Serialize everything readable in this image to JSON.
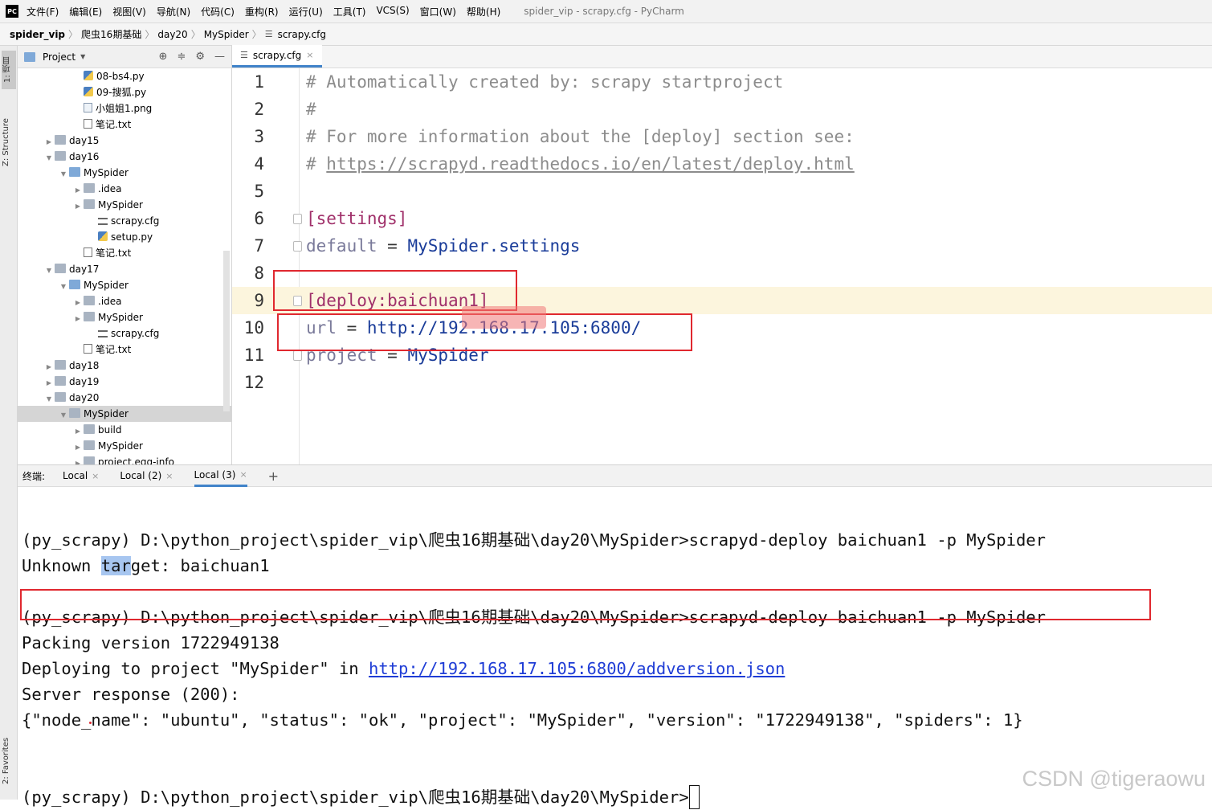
{
  "menubar": {
    "logo": "PC",
    "items": [
      "文件(F)",
      "编辑(E)",
      "视图(V)",
      "导航(N)",
      "代码(C)",
      "重构(R)",
      "运行(U)",
      "工具(T)",
      "VCS(S)",
      "窗口(W)",
      "帮助(H)"
    ],
    "window_title": "spider_vip - scrapy.cfg - PyCharm"
  },
  "breadcrumb": [
    "spider_vip",
    "爬虫16期基础",
    "day20",
    "MySpider",
    "scrapy.cfg"
  ],
  "left_strip": {
    "project": "1: 项目",
    "structure": "Z: Structure",
    "favorites": "2: Favorites"
  },
  "project_panel": {
    "title": "Project",
    "tree": [
      {
        "label": "08-bs4.py",
        "icon": "py-file-icon",
        "indent": 4,
        "arrow": ""
      },
      {
        "label": "09-搜狐.py",
        "icon": "py-file-icon",
        "indent": 4,
        "arrow": ""
      },
      {
        "label": "小姐姐1.png",
        "icon": "image-file-icon",
        "indent": 4,
        "arrow": ""
      },
      {
        "label": "笔记.txt",
        "icon": "text-file-icon",
        "indent": 4,
        "arrow": ""
      },
      {
        "label": "day15",
        "icon": "folder-icon",
        "indent": 2,
        "arrow": "▶"
      },
      {
        "label": "day16",
        "icon": "folder-icon",
        "indent": 2,
        "arrow": "▼"
      },
      {
        "label": "MySpider",
        "icon": "folder-blue-icon",
        "indent": 3,
        "arrow": "▼"
      },
      {
        "label": ".idea",
        "icon": "folder-icon",
        "indent": 4,
        "arrow": "▶"
      },
      {
        "label": "MySpider",
        "icon": "folder-icon",
        "indent": 4,
        "arrow": "▶"
      },
      {
        "label": "scrapy.cfg",
        "icon": "cfg-file-icon",
        "indent": 5,
        "arrow": ""
      },
      {
        "label": "setup.py",
        "icon": "py-file-icon",
        "indent": 5,
        "arrow": ""
      },
      {
        "label": "笔记.txt",
        "icon": "text-file-icon",
        "indent": 4,
        "arrow": ""
      },
      {
        "label": "day17",
        "icon": "folder-icon",
        "indent": 2,
        "arrow": "▼"
      },
      {
        "label": "MySpider",
        "icon": "folder-blue-icon",
        "indent": 3,
        "arrow": "▼"
      },
      {
        "label": ".idea",
        "icon": "folder-icon",
        "indent": 4,
        "arrow": "▶"
      },
      {
        "label": "MySpider",
        "icon": "folder-icon",
        "indent": 4,
        "arrow": "▶"
      },
      {
        "label": "scrapy.cfg",
        "icon": "cfg-file-icon",
        "indent": 5,
        "arrow": ""
      },
      {
        "label": "笔记.txt",
        "icon": "text-file-icon",
        "indent": 4,
        "arrow": ""
      },
      {
        "label": "day18",
        "icon": "folder-icon",
        "indent": 2,
        "arrow": "▶"
      },
      {
        "label": "day19",
        "icon": "folder-icon",
        "indent": 2,
        "arrow": "▶"
      },
      {
        "label": "day20",
        "icon": "folder-icon",
        "indent": 2,
        "arrow": "▼"
      },
      {
        "label": "MySpider",
        "icon": "folder-icon",
        "indent": 3,
        "arrow": "▼",
        "selected": true
      },
      {
        "label": "build",
        "icon": "folder-icon",
        "indent": 4,
        "arrow": "▶"
      },
      {
        "label": "MySpider",
        "icon": "folder-icon",
        "indent": 4,
        "arrow": "▶"
      },
      {
        "label": "project.egg-info",
        "icon": "folder-icon",
        "indent": 4,
        "arrow": "▶"
      }
    ]
  },
  "editor": {
    "tab_label": "scrapy.cfg",
    "current_line": 9,
    "lines": [
      {
        "n": "1",
        "parts": [
          {
            "t": "# Automatically created by: scrapy startproject",
            "c": "c-comment"
          }
        ]
      },
      {
        "n": "2",
        "parts": [
          {
            "t": "#",
            "c": "c-comment"
          }
        ]
      },
      {
        "n": "3",
        "parts": [
          {
            "t": "# For more information about the [deploy] section see:",
            "c": "c-comment"
          }
        ]
      },
      {
        "n": "4",
        "parts": [
          {
            "t": "# ",
            "c": "c-comment"
          },
          {
            "t": "https://scrapyd.readthedocs.io/en/latest/deploy.html",
            "c": "c-link"
          }
        ]
      },
      {
        "n": "5",
        "parts": []
      },
      {
        "n": "6",
        "parts": [
          {
            "t": "[settings]",
            "c": "c-section"
          }
        ],
        "fold": true
      },
      {
        "n": "7",
        "parts": [
          {
            "t": "default",
            "c": "c-key"
          },
          {
            "t": " = ",
            "c": "c-op"
          },
          {
            "t": "MySpider.settings",
            "c": "c-val"
          }
        ],
        "fold": true
      },
      {
        "n": "8",
        "parts": []
      },
      {
        "n": "9",
        "parts": [
          {
            "t": "[deploy:baichuan1]",
            "c": "c-section"
          }
        ],
        "fold": true
      },
      {
        "n": "10",
        "parts": [
          {
            "t": "url",
            "c": "c-key"
          },
          {
            "t": " = ",
            "c": "c-op"
          },
          {
            "t": "http://192.168.17.105:6800/",
            "c": "c-val"
          }
        ]
      },
      {
        "n": "11",
        "parts": [
          {
            "t": "project",
            "c": "c-key"
          },
          {
            "t": " = ",
            "c": "c-op"
          },
          {
            "t": "MySpider",
            "c": "c-val"
          }
        ],
        "fold": true
      },
      {
        "n": "12",
        "parts": []
      }
    ]
  },
  "terminal": {
    "label": "终端:",
    "tabs": [
      "Local",
      "Local (2)",
      "Local (3)"
    ],
    "active_tab": 2,
    "lines": [
      {
        "parts": [
          {
            "t": ""
          }
        ]
      },
      {
        "parts": [
          {
            "t": "(py_scrapy) D:\\python_project\\spider_vip\\爬虫16期基础\\day20\\MySpider>scrapyd-deploy baichuan1 -p MySpider"
          }
        ]
      },
      {
        "parts": [
          {
            "t": "Unknown "
          },
          {
            "t": "tar",
            "c": "term-sel"
          },
          {
            "t": "get: baichuan1"
          }
        ]
      },
      {
        "parts": [
          {
            "t": ""
          }
        ]
      },
      {
        "parts": [
          {
            "t": "(py_scrapy) D:\\python_project\\spider_vip\\爬虫16期基础\\day20\\MySpider>scrapyd-deploy baichuan1 -p MySpider"
          }
        ]
      },
      {
        "parts": [
          {
            "t": "Packing version 1722949138"
          }
        ]
      },
      {
        "parts": [
          {
            "t": "Deploying to project \"MySpider\" in "
          },
          {
            "t": "http://192.168.17.105:6800/addversion.json",
            "c": "term-link"
          }
        ]
      },
      {
        "parts": [
          {
            "t": "Server response (200):"
          }
        ]
      },
      {
        "parts": [
          {
            "t": "{\"node_name\": \"ubuntu\", \"status\": \"ok\", \"project\": \"MySpider\", \"version\": \"1722949138\", \"spiders\": 1}"
          }
        ]
      },
      {
        "parts": [
          {
            "t": ""
          }
        ]
      },
      {
        "parts": [
          {
            "t": ""
          }
        ]
      },
      {
        "parts": [
          {
            "t": "(py_scrapy) D:\\python_project\\spider_vip\\爬虫16期基础\\day20\\MySpider>"
          }
        ],
        "cursor": true
      }
    ]
  },
  "watermark": "CSDN @tigeraowu",
  "colors": {
    "highlight_box": "#e0282f",
    "current_line": "#fcf5dd",
    "accent": "#4083c9"
  }
}
